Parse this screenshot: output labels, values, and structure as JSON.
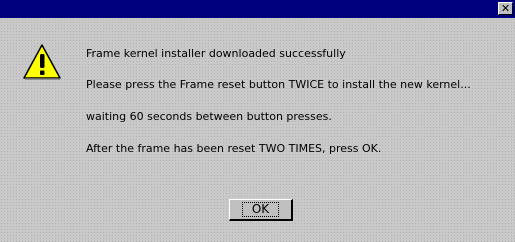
{
  "title_bar": {
    "close_label": "✕",
    "background_color": "#00007d"
  },
  "icon": "warning-icon",
  "message": {
    "line1": "Frame kernel installer downloaded successfully",
    "line2": "Please press the Frame reset button TWICE to install the new kernel...",
    "line3": "waiting 60 seconds between button presses.",
    "line4": "After the frame has been reset TWO TIMES, press OK."
  },
  "buttons": {
    "ok_label": "OK"
  }
}
